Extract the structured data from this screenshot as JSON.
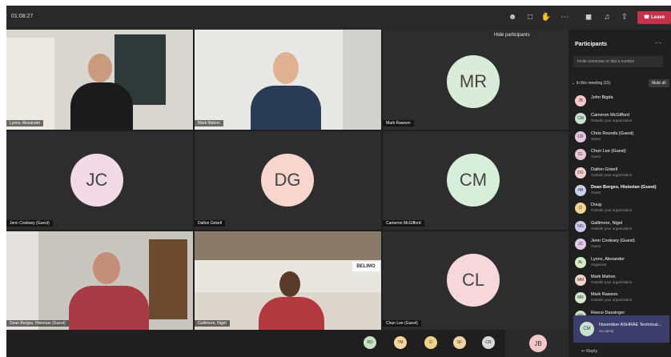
{
  "topbar": {
    "timer": "01:08:27",
    "leave_label": "Leave",
    "icons": [
      "participants-icon",
      "chat-icon",
      "raise-hand-icon",
      "more-icon",
      "camera-off-icon",
      "mic-icon",
      "share-icon"
    ]
  },
  "tooltip": "Hide participants",
  "tiles": [
    {
      "name": "Lyons, Alexander"
    },
    {
      "name": "Mark Mahon"
    },
    {
      "name": "Mark Rawson",
      "initials": "MR",
      "color": "#d9ecd9"
    },
    {
      "name": "Jenn Cooksey (Guest)",
      "initials": "JC",
      "color": "#f1d9e6"
    },
    {
      "name": "Dalton Grisell",
      "initials": "DG",
      "color": "#f7d6cd"
    },
    {
      "name": "Cameron McGifford",
      "initials": "CM",
      "color": "#d8eedb"
    },
    {
      "name": "Dean Borges, Historian (Guest)"
    },
    {
      "name": "Gallimore, Nigel"
    },
    {
      "name": "Chun Lee (Guest)",
      "initials": "CL",
      "color": "#f6d7dc"
    }
  ],
  "bottom_avatars": [
    {
      "initials": "RD",
      "color": "#c8e2c4"
    },
    {
      "initials": "TM",
      "color": "#f5d7a0"
    },
    {
      "initials": "D",
      "color": "#f2d38b"
    },
    {
      "initials": "SF",
      "color": "#f4d2a4"
    },
    {
      "initials": "CR",
      "color": "#d8d8d8"
    }
  ],
  "jb_tile": {
    "initials": "JB",
    "color": "#f6c7c9"
  },
  "panel": {
    "title": "Participants",
    "invite_placeholder": "Invite someone or dial a number",
    "section_label": "In this meeting (15)",
    "mute_all": "Mute all",
    "participants": [
      {
        "initials": "JB",
        "name": "John Bigda",
        "sub": "",
        "color": "#f6c7c9"
      },
      {
        "initials": "CM",
        "name": "Cameron McGifford",
        "sub": "Outside your organization",
        "color": "#c8e2d2"
      },
      {
        "initials": "CR",
        "name": "Chris Rounds (Guest)",
        "sub": "Guest",
        "color": "#e8c4e0"
      },
      {
        "initials": "CL",
        "name": "Chun Lee (Guest)",
        "sub": "Guest",
        "color": "#e9c6d6"
      },
      {
        "initials": "DG",
        "name": "Dalton Grisell",
        "sub": "Outside your organization",
        "color": "#f3cfcf"
      },
      {
        "initials": "HB",
        "name": "Dean Borges, Historian (Guest)",
        "sub": "Guest",
        "color": "#c9d3ec"
      },
      {
        "initials": "D",
        "name": "Doug",
        "sub": "Outside your organization",
        "color": "#f2d38b"
      },
      {
        "initials": "NG",
        "name": "Gallimore, Nigel",
        "sub": "Outside your organization",
        "color": "#cfc9ee"
      },
      {
        "initials": "JC",
        "name": "Jenn Cooksey (Guest)",
        "sub": "Guest",
        "color": "#e3c9e9"
      },
      {
        "initials": "AL",
        "name": "Lyons, Alexander",
        "sub": "Organizer",
        "color": "#d6ecc6"
      },
      {
        "initials": "MM",
        "name": "Mark Mahon",
        "sub": "Outside your organization",
        "color": "#f5d5cc"
      },
      {
        "initials": "MR",
        "name": "Mark Rawson",
        "sub": "Outside your organization",
        "color": "#d6e8cf"
      },
      {
        "initials": "RD",
        "name": "Reece Dassinger",
        "sub": "",
        "color": "#c8e2c4"
      }
    ]
  },
  "chat": {
    "initials": "CM",
    "title": "November ASHRAE Technical...",
    "subtitle": "no cams(",
    "reply": "Reply"
  }
}
